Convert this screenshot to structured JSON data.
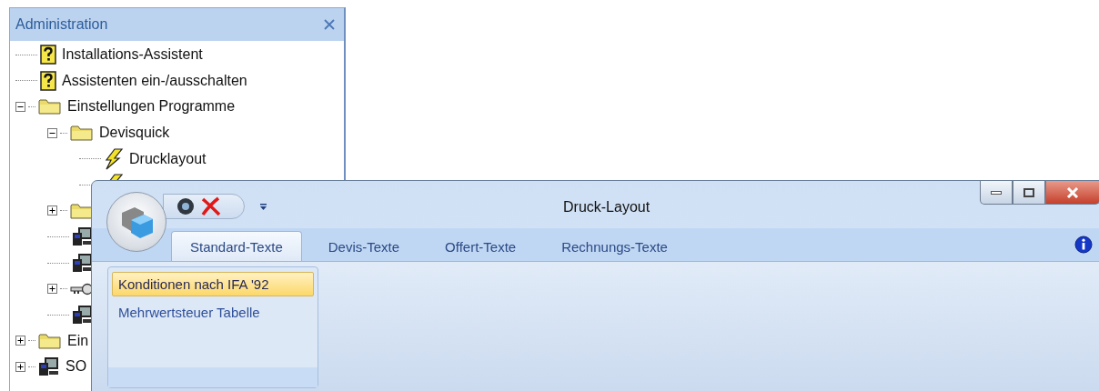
{
  "panel": {
    "title": "Administration",
    "tree": [
      {
        "kind": "help",
        "label": "Installations-Assistent"
      },
      {
        "kind": "help",
        "label": "Assistenten ein-/ausschalten"
      },
      {
        "kind": "folder",
        "label": "Einstellungen Programme",
        "expanded": true,
        "children": [
          {
            "kind": "folder",
            "label": "Devisquick",
            "expanded": true,
            "children": [
              {
                "kind": "action",
                "label": "Drucklayout"
              },
              {
                "kind": "action"
              }
            ]
          },
          {
            "kind": "folder",
            "expanded": false
          },
          {
            "kind": "computer"
          },
          {
            "kind": "computer"
          },
          {
            "kind": "key",
            "expanded": false
          },
          {
            "kind": "computer"
          }
        ]
      },
      {
        "kind": "folder",
        "label": "Ein",
        "expanded": false
      },
      {
        "kind": "computer",
        "label": "SO",
        "expanded": false
      }
    ]
  },
  "window": {
    "title": "Druck-Layout",
    "tabs": [
      {
        "label": "Standard-Texte",
        "selected": true
      },
      {
        "label": "Devis-Texte",
        "selected": false
      },
      {
        "label": "Offert-Texte",
        "selected": false
      },
      {
        "label": "Rechnungs-Texte",
        "selected": false
      }
    ],
    "items": [
      {
        "label": "Konditionen nach IFA '92",
        "selected": true
      },
      {
        "label": "Mehrwertsteuer Tabelle",
        "selected": false
      }
    ]
  }
}
